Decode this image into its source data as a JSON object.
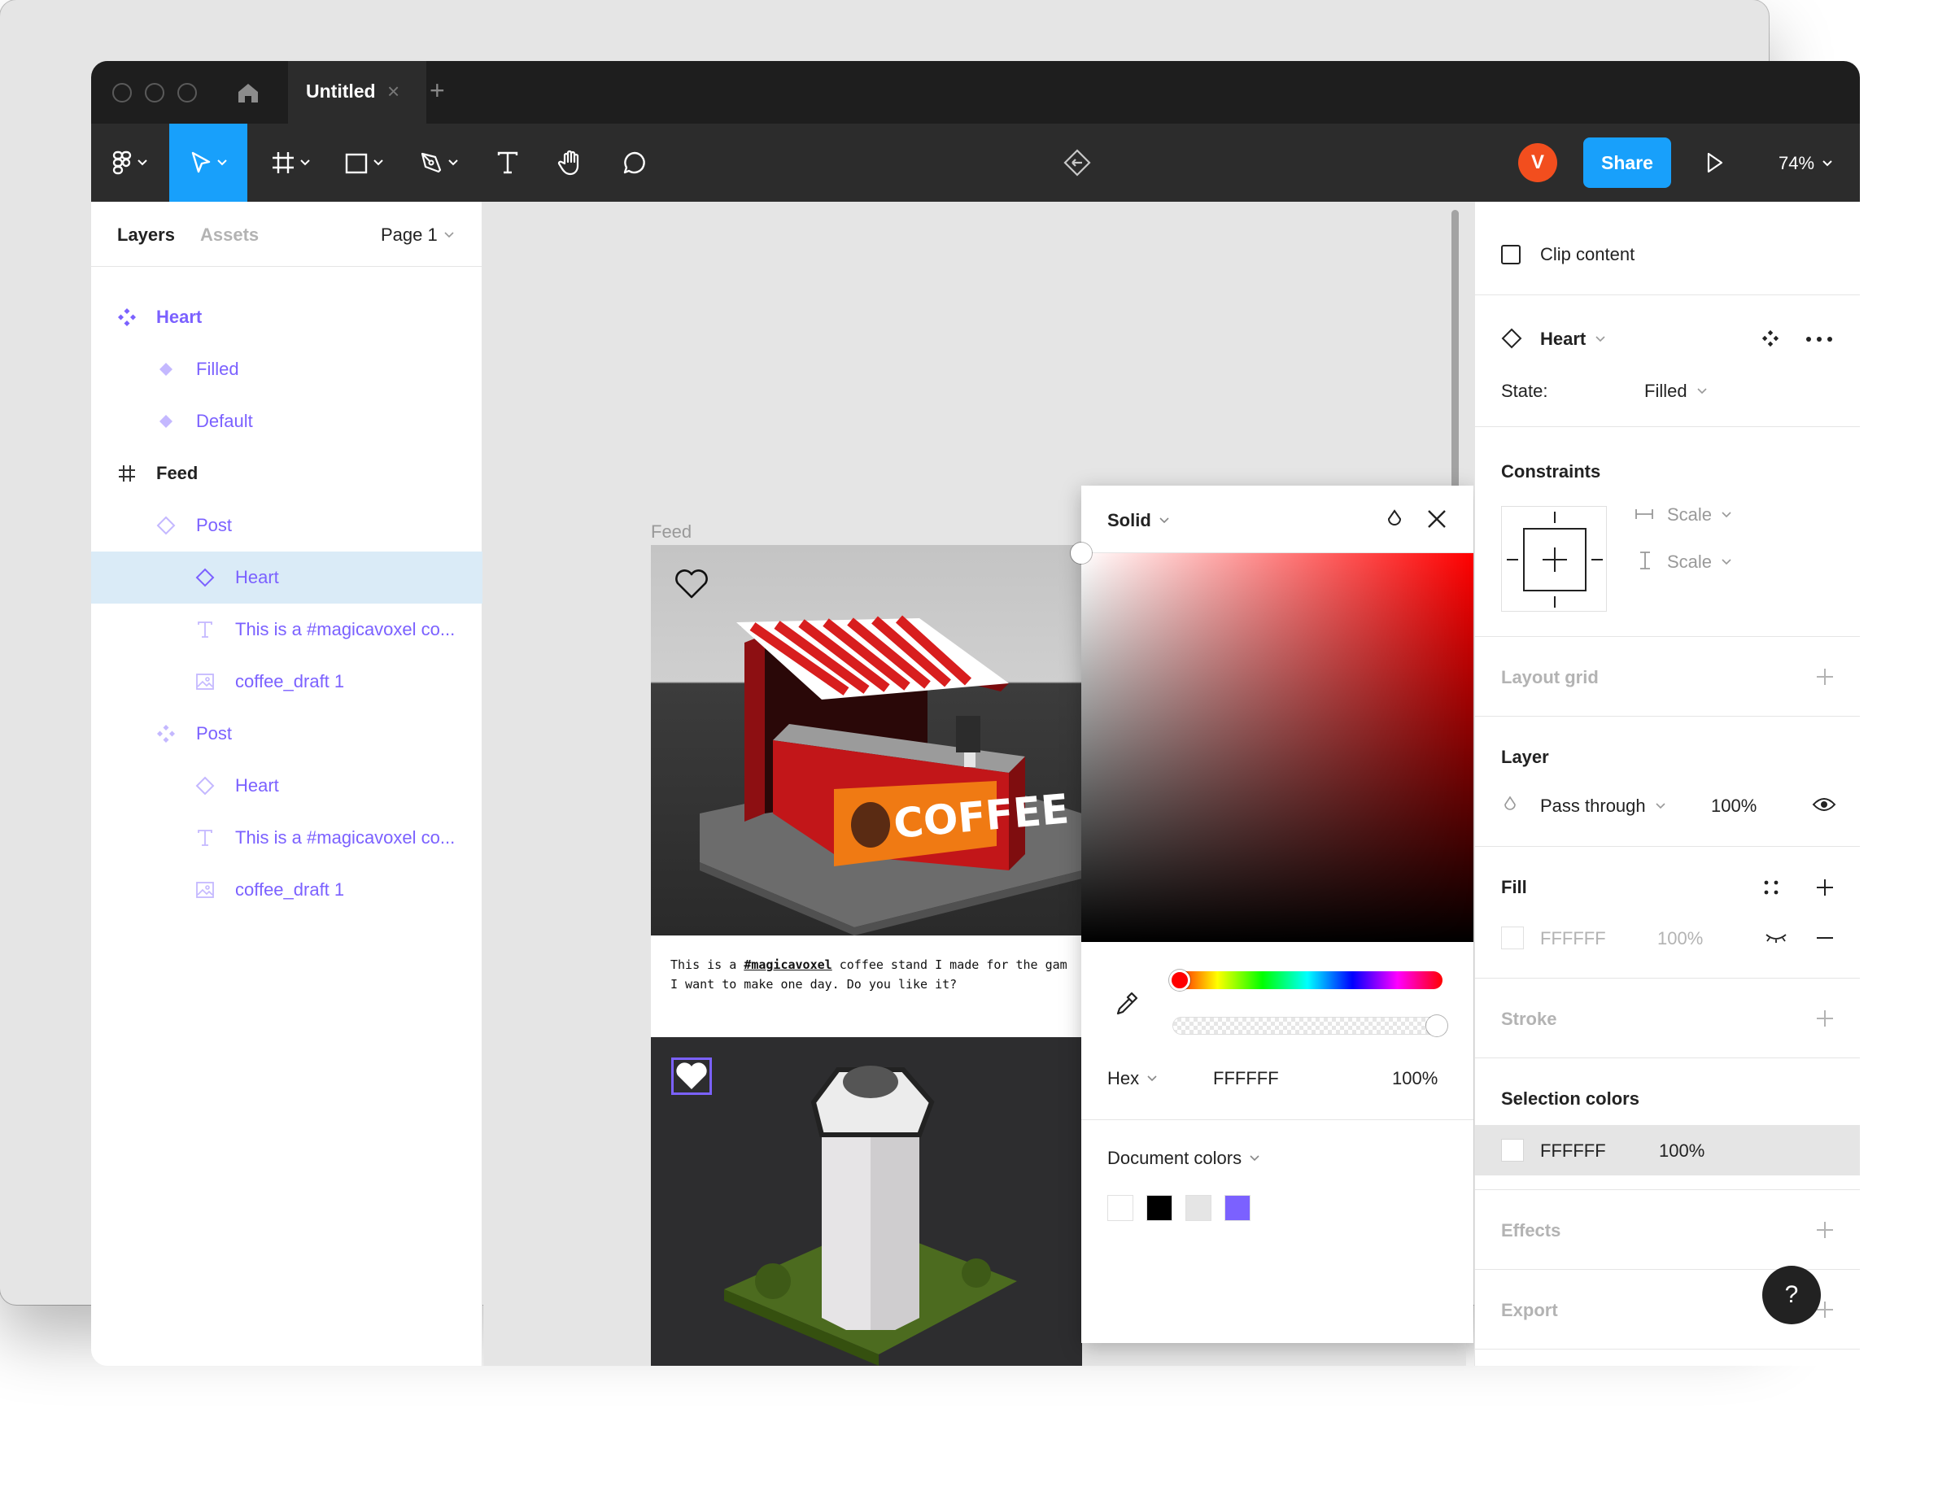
{
  "titlebar": {
    "tab_title": "Untitled",
    "tab_close": "×",
    "tab_add": "+"
  },
  "toolbar": {
    "share_label": "Share",
    "avatar_initial": "V",
    "zoom": "74%",
    "active_tool": "move"
  },
  "left_panel": {
    "tab_layers": "Layers",
    "tab_assets": "Assets",
    "page": "Page 1",
    "layers": [
      {
        "label": "Heart",
        "icon": "component-set-icon"
      },
      {
        "label": "Filled",
        "icon": "variant-icon"
      },
      {
        "label": "Default",
        "icon": "variant-icon"
      },
      {
        "label": "Feed",
        "icon": "frame-icon"
      },
      {
        "label": "Post",
        "icon": "instance-icon"
      },
      {
        "label": "Heart",
        "icon": "instance-icon"
      },
      {
        "label": "This is a #magicavoxel co...",
        "icon": "text-icon"
      },
      {
        "label": "coffee_draft 1",
        "icon": "image-icon"
      },
      {
        "label": "Post",
        "icon": "component-icon"
      },
      {
        "label": "Heart",
        "icon": "instance-icon"
      },
      {
        "label": "This is a #magicavoxel co...",
        "icon": "text-icon"
      },
      {
        "label": "coffee_draft 1",
        "icon": "image-icon"
      }
    ]
  },
  "canvas": {
    "frame_label": "Feed",
    "caption_line1_pre": "This is a ",
    "caption_tag": "#magicavoxel",
    "caption_line1_post": " coffee stand I made for the gam",
    "caption_line2": "I want to make one day. Do you like it?",
    "coffee_sign": "COFFEE"
  },
  "color_picker": {
    "mode": "Solid",
    "format": "Hex",
    "hex": "FFFFFF",
    "opacity": "100%",
    "document_colors_label": "Document colors",
    "document_colors": [
      "#ffffff",
      "#000000",
      "#e5e5e5",
      "#7b61ff"
    ]
  },
  "right_panel": {
    "clip_content": "Clip content",
    "component_name": "Heart",
    "state_label": "State:",
    "state_value": "Filled",
    "constraints_title": "Constraints",
    "constraint_h": "Scale",
    "constraint_v": "Scale",
    "layout_grid_title": "Layout grid",
    "layer_title": "Layer",
    "blend_mode": "Pass through",
    "layer_opacity": "100%",
    "fill_title": "Fill",
    "fill_hex": "FFFFFF",
    "fill_opacity": "100%",
    "stroke_title": "Stroke",
    "selection_colors_title": "Selection colors",
    "selection_hex": "FFFFFF",
    "selection_opacity": "100%",
    "effects_title": "Effects",
    "export_title": "Export",
    "help": "?"
  },
  "colors": {
    "accent": "#18a0fb",
    "component": "#7b61ff",
    "avatar": "#f24e1e"
  }
}
